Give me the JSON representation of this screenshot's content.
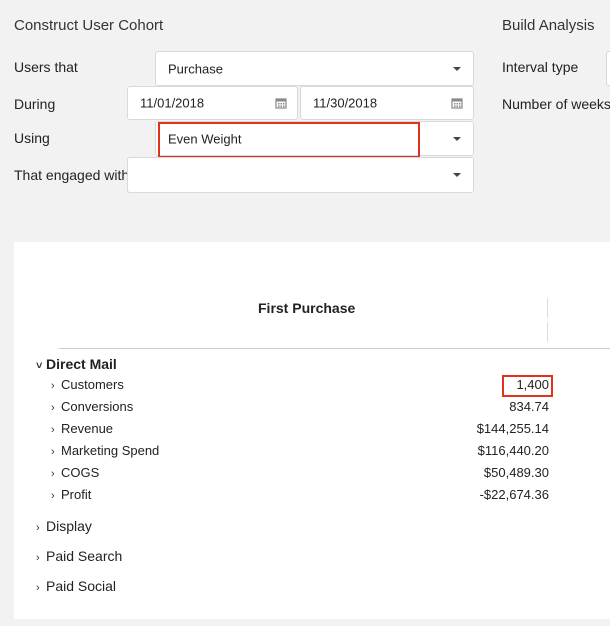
{
  "cohort": {
    "title": "Construct User Cohort",
    "users_that": {
      "label": "Users that",
      "value": "Purchase"
    },
    "during": {
      "label": "During",
      "start": "11/01/2018",
      "end": "11/30/2018"
    },
    "using": {
      "label": "Using",
      "value": "Even Weight"
    },
    "engaged_with": {
      "label": "That engaged with",
      "value": ""
    }
  },
  "analysis": {
    "title": "Build Analysis",
    "interval_type_label": "Interval type",
    "num_weeks_label": "Number of weeks"
  },
  "table": {
    "column_header": "First Purchase",
    "groups": [
      {
        "label": "Direct Mail",
        "expanded": true,
        "rows": [
          {
            "label": "Customers",
            "value": "1,400"
          },
          {
            "label": "Conversions",
            "value": "834.74"
          },
          {
            "label": "Revenue",
            "value": "$144,255.14"
          },
          {
            "label": "Marketing Spend",
            "value": "$116,440.20"
          },
          {
            "label": "COGS",
            "value": "$50,489.30"
          },
          {
            "label": "Profit",
            "value": "-$22,674.36"
          }
        ]
      },
      {
        "label": "Display",
        "expanded": false
      },
      {
        "label": "Paid Search",
        "expanded": false
      },
      {
        "label": "Paid Social",
        "expanded": false
      }
    ]
  },
  "icons": {
    "expand": "chevron-right-icon",
    "collapse": "chevron-down-icon",
    "calendar": "calendar-icon",
    "dropdown": "caret-down-icon"
  },
  "colors": {
    "highlight": "#e0321c",
    "background": "#f2f2f3"
  }
}
